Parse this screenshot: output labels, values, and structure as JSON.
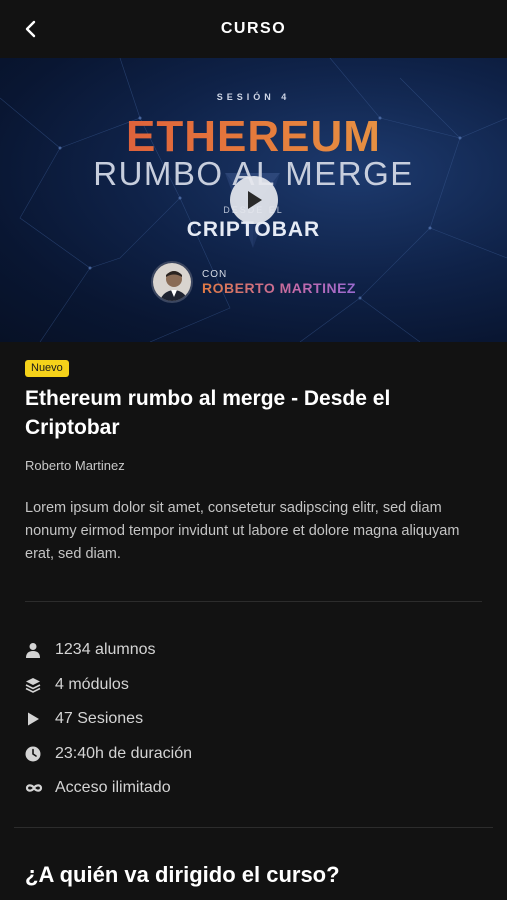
{
  "header": {
    "title": "CURSO"
  },
  "hero": {
    "session_label": "SESIÓN 4",
    "headline": "ETHEREUM",
    "subheadline": "RUMBO AL MERGE",
    "from_label": "DESDE EL",
    "venue": "CRIPTOBAR",
    "with_label": "CON",
    "presenter": "ROBERTO MARTINEZ"
  },
  "course": {
    "badge": "Nuevo",
    "title": "Ethereum rumbo al merge - Desde el Criptobar",
    "author": "Roberto Martinez",
    "description": "Lorem ipsum dolor sit amet, consetetur sadipscing elitr, sed diam nonumy eirmod tempor invidunt ut labore et dolore magna aliquyam erat, sed diam."
  },
  "stats": [
    {
      "icon": "user-icon",
      "text": "1234 alumnos"
    },
    {
      "icon": "layers-icon",
      "text": "4 módulos"
    },
    {
      "icon": "play-icon",
      "text": "47 Sesiones"
    },
    {
      "icon": "clock-icon",
      "text": "23:40h de duración"
    },
    {
      "icon": "infinity-icon",
      "text": "Acceso ilimitado"
    }
  ],
  "section": {
    "audience_heading": "¿A quién va dirigido el curso?"
  },
  "colors": {
    "background": "#121212",
    "badge": "#f5d21a",
    "hero_bg": "#0f2248"
  }
}
